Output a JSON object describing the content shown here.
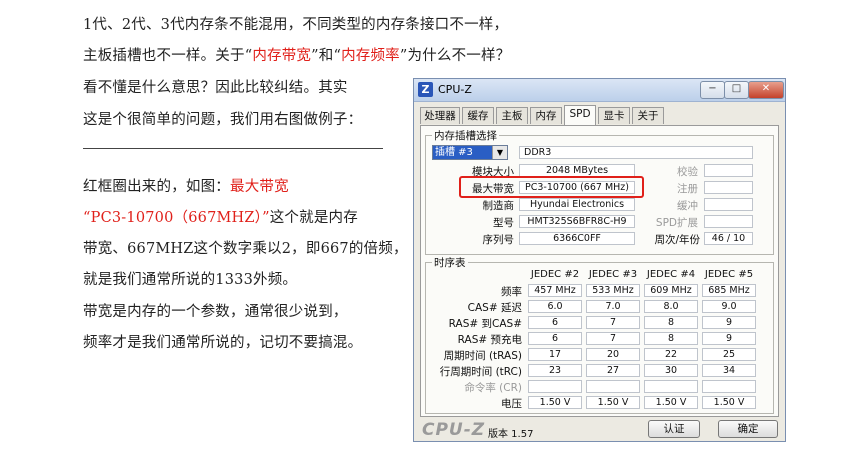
{
  "article": {
    "l1": "1代、2代、3代内存条不能混用，不同类型的内存条接口不一样，",
    "l2a": "主板插槽也不一样。关于“",
    "l2b": "内存带宽",
    "l2c": "”和“",
    "l2d": "内存频率",
    "l2e": "”为什么不一样？",
    "l3": "看不懂是什么意思？因此比较纠结。其实",
    "l4": "这是个很简单的问题，我们用右图做例子：",
    "l5a": "红框圈出来的，如图：",
    "l5b": "最大带宽",
    "l6a": "“PC3-10700（667MHZ）”",
    "l6b": "这个就是内存",
    "l7": "带宽、667MHZ这个数字乘以2，即667的倍频，",
    "l8": "就是我们通常所说的1333外频。",
    "l9": "带宽是内存的一个参数，通常很少说到，",
    "l10": "频率才是我们通常所说的，记切不要搞混。"
  },
  "cpuz": {
    "title": "CPU-Z",
    "tabs": [
      "处理器",
      "缓存",
      "主板",
      "内存",
      "SPD",
      "显卡",
      "关于"
    ],
    "slot_group": "内存插槽选择",
    "slot_value": "插槽 #3",
    "mem_type": "DDR3",
    "labels": {
      "module_size": "模块大小",
      "max_bandwidth": "最大带宽",
      "manufacturer": "制造商",
      "part_number": "型号",
      "serial": "序列号",
      "correction": "校验",
      "registered": "注册",
      "buffered": "缓冲",
      "spd_ext": "SPD扩展",
      "week_year": "周次/年份"
    },
    "values": {
      "module_size": "2048 MBytes",
      "max_bandwidth": "PC3-10700 (667 MHz)",
      "manufacturer": "Hyundai Electronics",
      "part_number": "HMT325S6BFR8C-H9",
      "serial": "6366C0FF",
      "week_year": "46 / 10"
    },
    "timing_group": "时序表",
    "timing_headers": [
      "JEDEC #2",
      "JEDEC #3",
      "JEDEC #4",
      "JEDEC #5"
    ],
    "timing_rows": [
      {
        "label": "频率",
        "values": [
          "457 MHz",
          "533 MHz",
          "609 MHz",
          "685 MHz"
        ]
      },
      {
        "label": "CAS# 延迟",
        "values": [
          "6.0",
          "7.0",
          "8.0",
          "9.0"
        ]
      },
      {
        "label": "RAS# 到CAS#",
        "values": [
          "6",
          "7",
          "8",
          "9"
        ]
      },
      {
        "label": "RAS# 预充电",
        "values": [
          "6",
          "7",
          "8",
          "9"
        ]
      },
      {
        "label": "周期时间 (tRAS)",
        "values": [
          "17",
          "20",
          "22",
          "25"
        ]
      },
      {
        "label": "行周期时间 (tRC)",
        "values": [
          "23",
          "27",
          "30",
          "34"
        ]
      },
      {
        "label": "命令率 (CR)",
        "values": [
          "",
          "",
          "",
          ""
        ]
      },
      {
        "label": "电压",
        "values": [
          "1.50 V",
          "1.50 V",
          "1.50 V",
          "1.50 V"
        ]
      }
    ],
    "logo": "CPU-Z",
    "version": "版本 1.57",
    "validate_btn": "认证",
    "ok_btn": "确定",
    "titlebar_buttons": [
      "−",
      "□",
      "✕"
    ]
  },
  "colors": {
    "highlight": "#e0201a",
    "window_border": "#7a8fb0"
  }
}
